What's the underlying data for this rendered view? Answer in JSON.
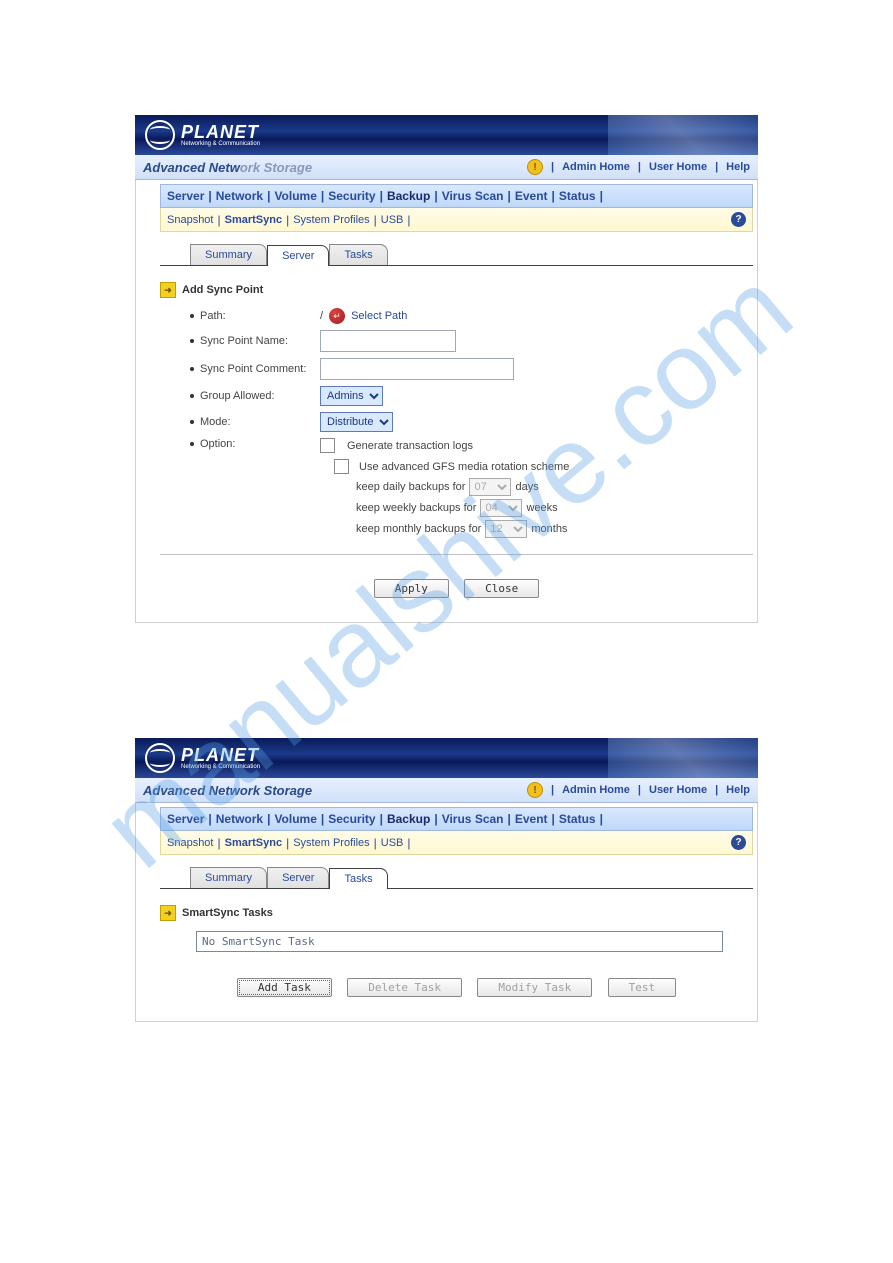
{
  "brand": {
    "name": "PLANET",
    "tagline": "Networking & Communication",
    "title_prefix": "Advanced Netw",
    "title_suffix": "ork Storage"
  },
  "toplinks": {
    "admin": "Admin Home",
    "user": "User Home",
    "help": "Help"
  },
  "mainnav": [
    "Server",
    "Network",
    "Volume",
    "Security",
    "Backup",
    "Virus Scan",
    "Event",
    "Status"
  ],
  "mainnav_active": "Backup",
  "subnav": [
    "Snapshot",
    "SmartSync",
    "System Profiles",
    "USB"
  ],
  "subnav_active": "SmartSync",
  "tabs_s1": [
    "Summary",
    "Server",
    "Tasks"
  ],
  "tabs_s1_active": "Server",
  "tabs_s2": [
    "Summary",
    "Server",
    "Tasks"
  ],
  "tabs_s2_active": "Tasks",
  "s1": {
    "title": "Add Sync Point",
    "path_label": "Path:",
    "path_slash": "/",
    "select_path": "Select Path",
    "name_label": "Sync Point Name:",
    "name_value": "",
    "comment_label": "Sync Point Comment:",
    "comment_value": "",
    "group_label": "Group Allowed:",
    "group_value": "Admins",
    "mode_label": "Mode:",
    "mode_value": "Distribute",
    "option_label": "Option:",
    "opt1": "Generate transaction logs",
    "opt2": "Use advanced GFS media rotation scheme",
    "daily_pre": "keep daily backups for",
    "daily_val": "07",
    "daily_post": "days",
    "weekly_pre": "keep weekly backups for",
    "weekly_val": "04",
    "weekly_post": "weeks",
    "monthly_pre": "keep monthly backups for",
    "monthly_val": "12",
    "monthly_post": "months",
    "apply": "Apply",
    "close": "Close"
  },
  "s2": {
    "title": "SmartSync Tasks",
    "empty": "No SmartSync Task",
    "add": "Add Task",
    "del": "Delete Task",
    "mod": "Modify Task",
    "test": "Test"
  }
}
